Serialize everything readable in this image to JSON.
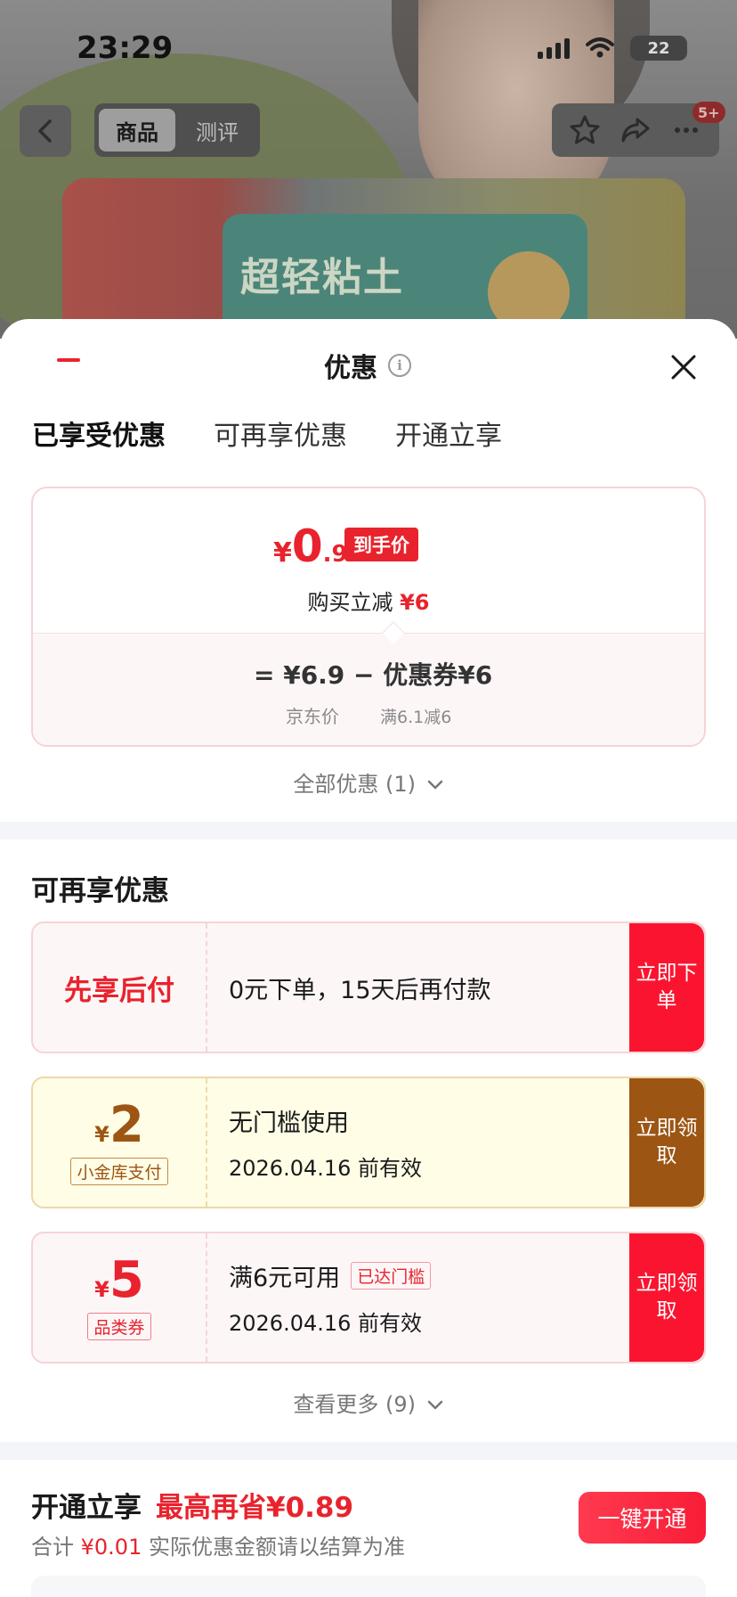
{
  "status_bar": {
    "time": "23:29",
    "battery": "22"
  },
  "header": {
    "segments": [
      {
        "label": "商品"
      },
      {
        "label": "测评"
      }
    ],
    "notification_badge": "5+"
  },
  "product_art": {
    "text": "超轻粘土"
  },
  "sheet": {
    "title": "优惠",
    "tabs": [
      {
        "label": "已享受优惠"
      },
      {
        "label": "可再享优惠"
      },
      {
        "label": "开通立享"
      }
    ],
    "price_card": {
      "currency": "¥",
      "price_int": "0",
      "price_dec": ".9",
      "price_tag": "到手价",
      "subtitle_prefix": "购买立减",
      "subtitle_amount": "¥6",
      "formula": "=  ¥6.9  −  优惠券¥6",
      "label_jd_price": "京东价",
      "label_coupon_rule": "满6.1减6"
    },
    "all_offers": "全部优惠 (1)",
    "more_offers_title": "可再享优惠",
    "coupons": [
      {
        "left_label": "先享后付",
        "line1": "0元下单，15天后再付款",
        "action": "立即下单"
      },
      {
        "currency": "¥",
        "amount": "2",
        "tag": "小金库支付",
        "line1": "无门槛使用",
        "line2": "2026.04.16 前有效",
        "action": "立即领取"
      },
      {
        "currency": "¥",
        "amount": "5",
        "tag": "品类券",
        "line1": "满6元可用",
        "line1_tag": "已达门槛",
        "line2": "2026.04.16 前有效",
        "action": "立即领取"
      }
    ],
    "see_more": "查看更多 (9)",
    "open_section": {
      "title": "开通立享",
      "highlight": "最高再省¥0.89",
      "sub_prefix": "合计",
      "sub_amount": "¥0.01",
      "sub_note": "实际优惠金额请以结算为准",
      "button": "一键开通"
    }
  },
  "colors": {
    "accent_red": "#e8232d",
    "brown": "#9d5513",
    "action_red": "#fb1430"
  }
}
